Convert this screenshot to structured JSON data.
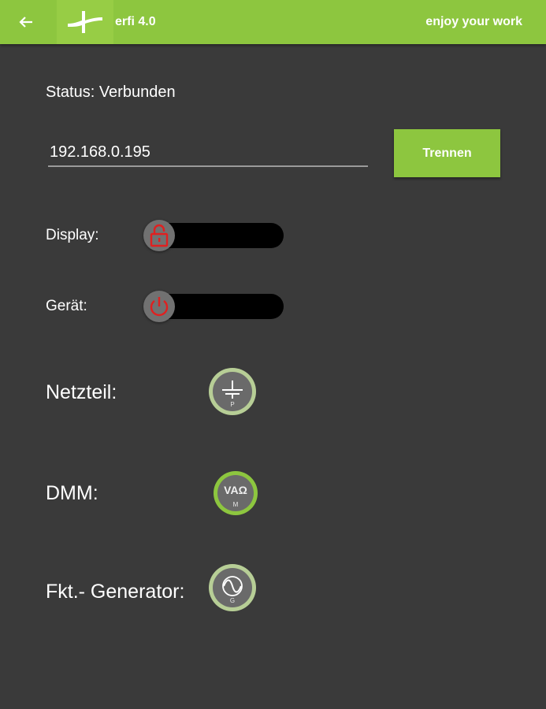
{
  "header": {
    "title": "erfi 4.0",
    "tagline": "enjoy your work",
    "back_icon": "arrow-left-icon",
    "logo_icon": "erfi-logo-icon"
  },
  "connection": {
    "status": "Status: Verbunden",
    "ip_value": "192.168.0.195",
    "disconnect_label": "Trennen"
  },
  "controls": {
    "display_label": "Display:",
    "display_icon": "lock-open-icon",
    "device_label": "Gerät:",
    "device_icon": "power-icon",
    "power_supply_label": "Netzteil:",
    "power_supply_icon_letter": "P",
    "dmm_label": "DMM:",
    "dmm_icon_text": "VAΩ",
    "dmm_icon_letter": "M",
    "generator_label": "Fkt.- Generator:",
    "generator_icon_letter": "G"
  },
  "colors": {
    "accent": "#8dc63f",
    "background": "#3a3a3a",
    "icon_red": "#e02020"
  }
}
